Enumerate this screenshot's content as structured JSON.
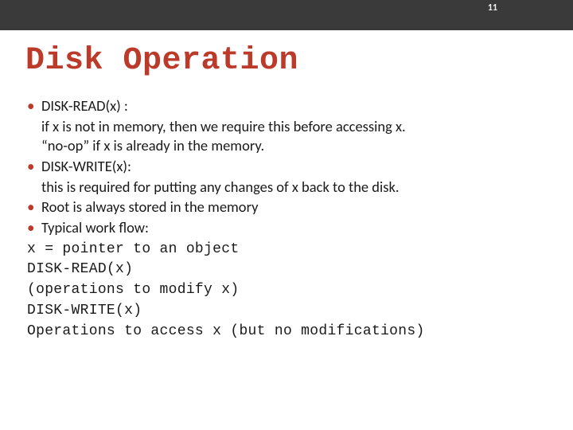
{
  "page_number": "11",
  "title": "Disk Operation",
  "bullets": [
    {
      "head": "DISK-READ(x) :",
      "lines": [
        "if x is not in memory, then we require this before accessing x.",
        "“no-op” if x is already in the memory."
      ]
    },
    {
      "head": "DISK-WRITE(x):",
      "lines": [
        "this is required for putting any changes of x back to the disk."
      ]
    },
    {
      "head": "Root is always stored in the memory",
      "lines": []
    },
    {
      "head": "Typical work flow:",
      "lines": []
    }
  ],
  "code": [
    "x = pointer to an object",
    "DISK-READ(x)",
    "(operations to modify x)",
    "DISK-WRITE(x)",
    "Operations to access x (but no modifications)"
  ]
}
